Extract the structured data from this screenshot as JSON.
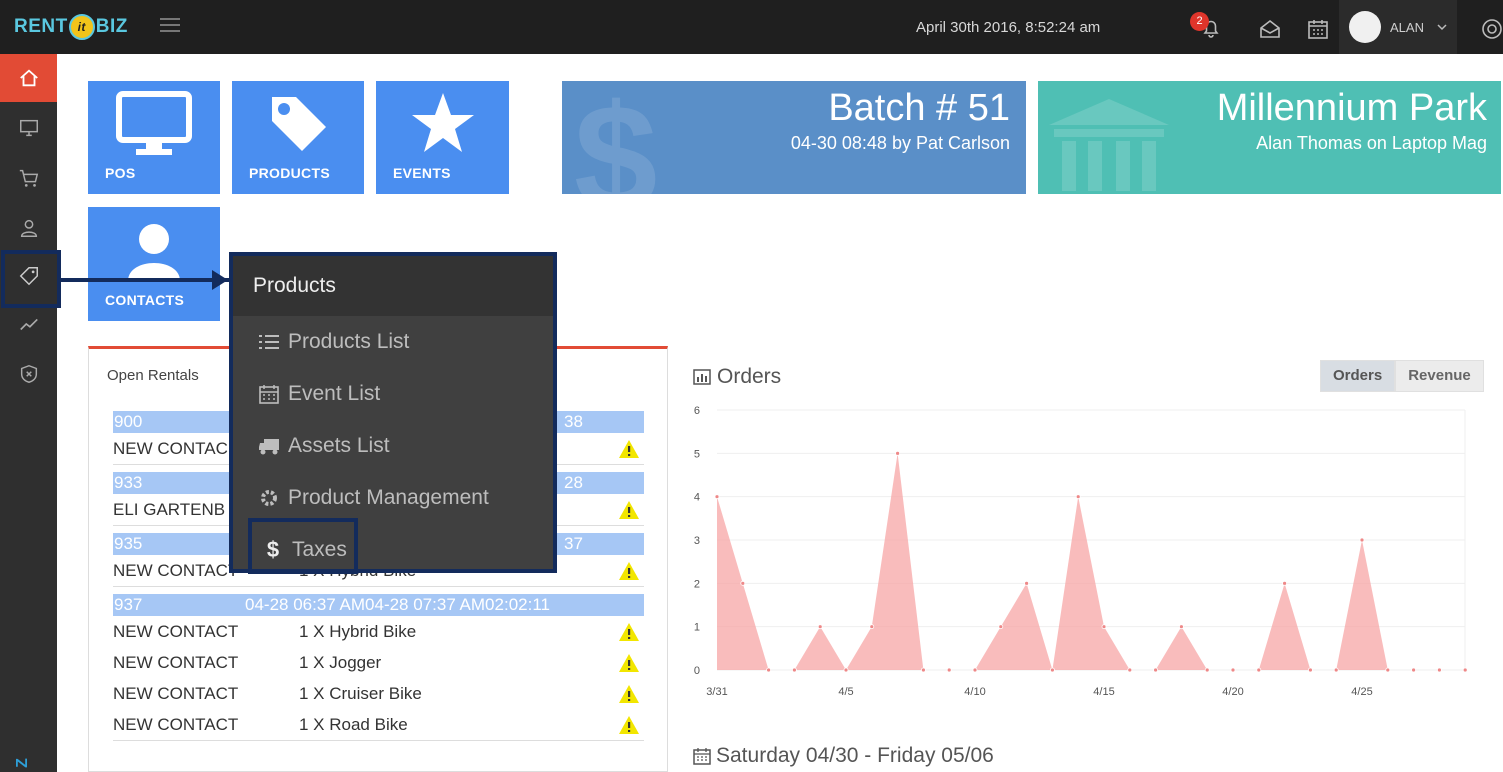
{
  "topbar": {
    "logo": {
      "left": "RENT",
      "mid": "it",
      "right": "BIZ"
    },
    "datetime": "April 30th 2016, 8:52:24 am",
    "notification_count": "2",
    "user_name": "ALAN",
    "icons": [
      "menu-icon",
      "bell-icon",
      "inbox-icon",
      "calendar-icon",
      "chevron-down-icon",
      "support-icon"
    ]
  },
  "sidebar": {
    "items": [
      "home-icon",
      "monitor-icon",
      "cart-icon",
      "contacts-icon",
      "tag-icon",
      "chart-line-icon",
      "shield-icon"
    ],
    "footer_letter": "Z"
  },
  "tiles": {
    "pos": "POS",
    "products": "PRODUCTS",
    "events": "EVENTS",
    "contacts": "CONTACTS"
  },
  "batch": {
    "title": "Batch # 51",
    "subtitle": "04-30 08:48 by Pat Carlson"
  },
  "location": {
    "title": "Millennium Park",
    "subtitle": "Alan Thomas on Laptop Mag"
  },
  "rentals": {
    "title": "Open Rentals",
    "groups": [
      {
        "id": "900",
        "times": "38",
        "rows": [
          {
            "contact": "NEW CONTAC",
            "item": ""
          }
        ]
      },
      {
        "id": "933",
        "times": "28",
        "rows": [
          {
            "contact": "ELI GARTENB",
            "item": ""
          }
        ]
      },
      {
        "id": "935",
        "times": "37",
        "rows": [
          {
            "contact": "NEW CONTACT",
            "item": "1 X Hybrid Bike"
          }
        ]
      },
      {
        "id": "937",
        "times": "04-28 06:37 AM04-28 07:37 AM02:02:11",
        "rows": [
          {
            "contact": "NEW CONTACT",
            "item": "1 X Hybrid Bike"
          },
          {
            "contact": "NEW CONTACT",
            "item": "1 X Jogger"
          },
          {
            "contact": "NEW CONTACT",
            "item": "1 X Cruiser Bike"
          },
          {
            "contact": "NEW CONTACT",
            "item": "1 X Road Bike"
          }
        ]
      }
    ]
  },
  "products_menu": {
    "title": "Products",
    "items": [
      {
        "label": "Products List",
        "icon": "list-icon"
      },
      {
        "label": "Event List",
        "icon": "calendar-icon"
      },
      {
        "label": "Assets List",
        "icon": "truck-icon"
      },
      {
        "label": "Product Management",
        "icon": "gear-icon"
      },
      {
        "label": "Taxes",
        "icon": "dollar-icon"
      }
    ]
  },
  "orders": {
    "title": "Orders",
    "toggle": {
      "orders": "Orders",
      "revenue": "Revenue",
      "selected": "Orders"
    },
    "week_label": "Saturday 04/30 - Friday 05/06"
  },
  "chart_data": {
    "type": "area",
    "title": "Orders",
    "x": [
      "3/31",
      "4/1",
      "4/2",
      "4/3",
      "4/4",
      "4/5",
      "4/6",
      "4/7",
      "4/8",
      "4/9",
      "4/10",
      "4/11",
      "4/12",
      "4/13",
      "4/14",
      "4/15",
      "4/16",
      "4/17",
      "4/18",
      "4/19",
      "4/20",
      "4/21",
      "4/22",
      "4/23",
      "4/24",
      "4/25",
      "4/26",
      "4/27",
      "4/28",
      "4/29"
    ],
    "values": [
      4,
      2,
      0,
      0,
      1,
      0,
      1,
      5,
      0,
      0,
      0,
      1,
      2,
      0,
      4,
      1,
      0,
      0,
      1,
      0,
      0,
      0,
      2,
      0,
      0,
      3,
      0,
      0,
      0,
      0
    ],
    "xticks": [
      "3/31",
      "4/5",
      "4/10",
      "4/15",
      "4/20",
      "4/25"
    ],
    "yticks": [
      0,
      1,
      2,
      3,
      4,
      5,
      6
    ],
    "ylim": [
      0,
      6
    ],
    "color": "#f7a6a6",
    "grid": true
  }
}
